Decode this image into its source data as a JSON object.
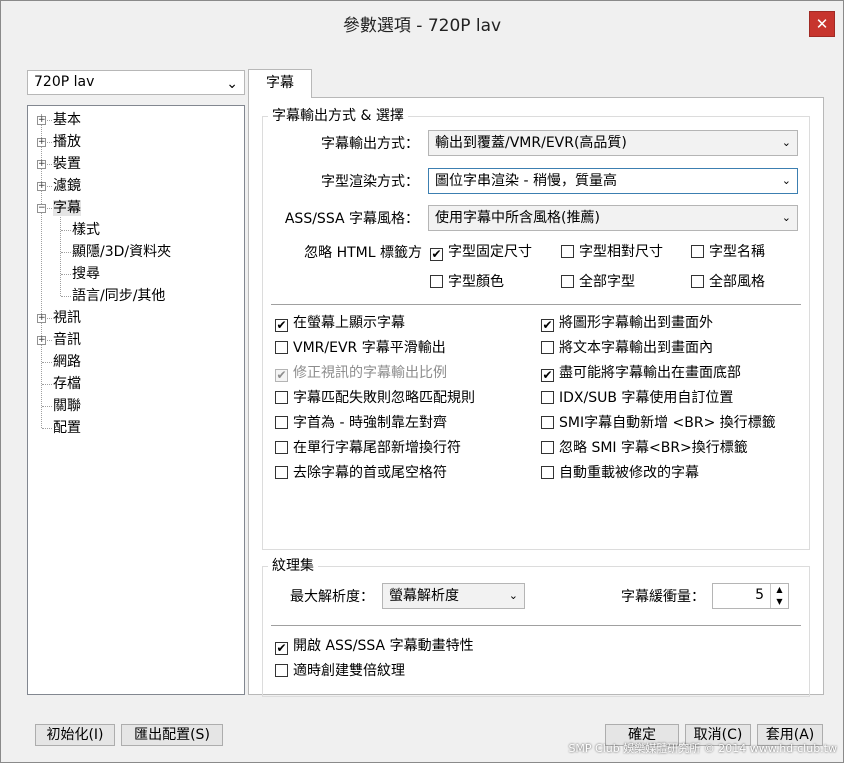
{
  "window": {
    "title": "參數選項 - 720P lav",
    "close": "✕"
  },
  "nav": {
    "select": {
      "value": "720P lav",
      "arrow": "⌄"
    },
    "tree": [
      {
        "label": "基本",
        "toggle": "+"
      },
      {
        "label": "播放",
        "toggle": "+"
      },
      {
        "label": "裝置",
        "toggle": "+"
      },
      {
        "label": "濾鏡",
        "toggle": "+"
      },
      {
        "label": "字幕",
        "toggle": "−"
      },
      {
        "label": "樣式"
      },
      {
        "label": "顯隱/3D/資料夾"
      },
      {
        "label": "搜尋"
      },
      {
        "label": "語言/同步/其他"
      },
      {
        "label": "視訊",
        "toggle": "+"
      },
      {
        "label": "音訊",
        "toggle": "+"
      },
      {
        "label": "網路"
      },
      {
        "label": "存檔"
      },
      {
        "label": "關聯"
      },
      {
        "label": "配置"
      }
    ]
  },
  "buttons": {
    "init": "初始化(I)",
    "export": "匯出配置(S)",
    "ok": "確定",
    "cancel": "取消(C)",
    "apply": "套用(A)"
  },
  "tab": {
    "label": "字幕"
  },
  "output_group": {
    "title": "字幕輸出方式 & 選擇",
    "rows": [
      {
        "label": "字幕輸出方式：",
        "value": "輸出到覆蓋/VMR/EVR(高品質)"
      },
      {
        "label": "字型渲染方式：",
        "value": "圖位字串渲染 - 稍慢，質量高"
      },
      {
        "label": "ASS/SSA 字幕風格：",
        "value": "使用字幕中所含風格(推薦)"
      }
    ],
    "ignore_label": "忽略 HTML 標籤方",
    "ignore_options": [
      {
        "label": "字型固定尺寸",
        "checked": true
      },
      {
        "label": "字型相對尺寸",
        "checked": false
      },
      {
        "label": "字型名稱",
        "checked": false
      },
      {
        "label": "字型顏色",
        "checked": false
      },
      {
        "label": "全部字型",
        "checked": false
      },
      {
        "label": "全部風格",
        "checked": false
      }
    ],
    "options_left": [
      {
        "label": "在螢幕上顯示字幕",
        "checked": true
      },
      {
        "label": "VMR/EVR 字幕平滑輸出",
        "checked": false
      },
      {
        "label": "修正視訊的字幕輸出比例",
        "checked": true,
        "disabled": true
      },
      {
        "label": "字幕匹配失敗則忽略匹配規則",
        "checked": false
      },
      {
        "label": "字首為 - 時強制靠左對齊",
        "checked": false
      },
      {
        "label": "在單行字幕尾部新增換行符",
        "checked": false
      },
      {
        "label": "去除字幕的首或尾空格符",
        "checked": false
      }
    ],
    "options_right": [
      {
        "label": "將圖形字幕輸出到畫面外",
        "checked": true
      },
      {
        "label": "將文本字幕輸出到畫面內",
        "checked": false
      },
      {
        "label": "盡可能將字幕輸出在畫面底部",
        "checked": true
      },
      {
        "label": "IDX/SUB 字幕使用自訂位置",
        "checked": false
      },
      {
        "label": "SMI字幕自動新增 <BR> 換行標籤",
        "checked": false
      },
      {
        "label": "忽略 SMI 字幕<BR>換行標籤",
        "checked": false
      },
      {
        "label": "自動重載被修改的字幕",
        "checked": false
      }
    ]
  },
  "texture_group": {
    "title": "紋理集",
    "max_res_label": "最大解析度：",
    "max_res_value": "螢幕解析度",
    "buffer_label": "字幕緩衝量：",
    "buffer_value": "5",
    "options": [
      {
        "label": "開啟 ASS/SSA 字幕動畫特性",
        "checked": true
      },
      {
        "label": "適時創建雙倍紋理",
        "checked": false
      }
    ]
  },
  "icons": {
    "check": "✔",
    "arrow": "⌄",
    "spin_up": "▲",
    "spin_down": "▼"
  },
  "watermark": "SMP Club 娛樂媒體研究所 © 2014 www.hd-club.tw"
}
